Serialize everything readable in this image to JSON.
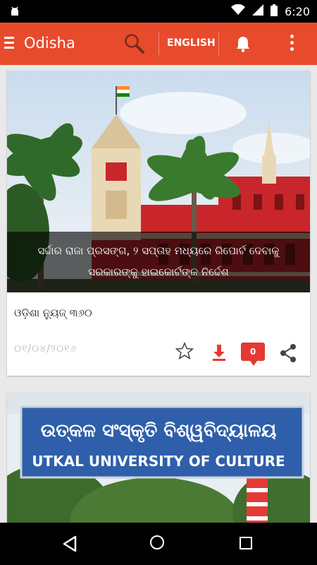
{
  "status_bar": {
    "time": "6:20"
  },
  "app_bar": {
    "title": "Odisha",
    "language_button": "ENGLISH"
  },
  "feed": [
    {
      "headline_line1": "ସର୍ଦ୍ଦାର ରାଜା ପ୍ରସଙ୍ଗ, ୨ ସପ୍ତାହ ମଧ୍ୟରେ ରିପୋର୍ଟ ଦେବାକୁ",
      "headline_line2": "ସରକାରଙ୍କୁ ହାଇକୋର୍ଟଙ୍କ ନିର୍ଦ୍ଦେଶ",
      "source": "ଓଡ଼ିଶା ନ୍ୟୁଜ୍ ୩୬୦",
      "date": "୦୧/୦୪/୨୦୧୬",
      "comment_count": "0"
    },
    {
      "image_sign_line1": "ଉତ୍କଳ ସଂସ୍କୃତି ବିଶ୍ୱବିଦ୍ୟାଳୟ",
      "image_sign_line2": "UTKAL UNIVERSITY OF CULTURE"
    }
  ],
  "colors": {
    "primary": "#e84a2c",
    "comment_badge": "#e53935",
    "download_icon": "#e53935"
  }
}
